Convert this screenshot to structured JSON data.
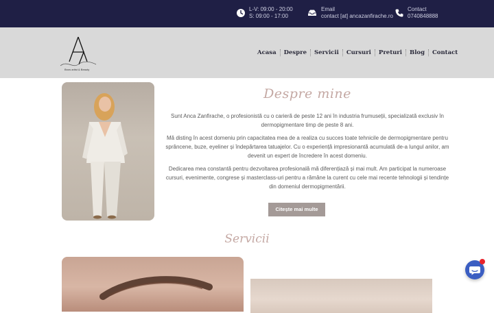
{
  "topbar": {
    "hours_line1": "L-V: 09:00 - 20:00",
    "hours_line2": "S: 09:00 - 17:00",
    "email_label": "Email",
    "email_value": "contact [at] ancazanfirache.ro",
    "contact_label": "Contact",
    "contact_value": "0740848888",
    "icons": [
      "clock-icon",
      "email-icon",
      "phone-icon"
    ]
  },
  "logo": {
    "caption": "Brow artist & Beauty",
    "signature": "Anca Zanfirache"
  },
  "nav": {
    "items": [
      "Acasa",
      "Despre",
      "Servicii",
      "Cursuri",
      "Preturi",
      "Blog",
      "Contact"
    ]
  },
  "about": {
    "title": "Despre mine",
    "p1": "Sunt Anca Zanfirache, o profesionistă cu o carieră de peste 12 ani în industria frumuseții, specializată exclusiv în dermopigmentare timp de peste 8 ani.",
    "p2": "Mă disting în acest domeniu prin capacitatea mea de a realiza cu succes toate tehnicile de dermopigmentare pentru sprâncene, buze, eyeliner și îndepărtarea tatuajelor. Cu o experiență impresionantă acumulată de-a lungul anilor, am devenit un expert de încredere în acest domeniu.",
    "p3": "Dedicarea mea constantă pentru dezvoltarea profesională mă diferențiază și mai mult. Am participat la numeroase cursuri, evenimente, congrese și masterclass-uri pentru a rămâne la curent cu cele mai recente tehnologii și tendințe din domeniul dermopigmentării.",
    "button": "Citește mai multe"
  },
  "services": {
    "title": "Servicii"
  },
  "colors": {
    "topbar_bg": "#1f1f45",
    "header_bg": "#d9d9d9",
    "accent": "#c4a8a3",
    "button_bg": "#a49a97",
    "chat_bg": "#3b5ec2",
    "badge": "#e8232b"
  }
}
